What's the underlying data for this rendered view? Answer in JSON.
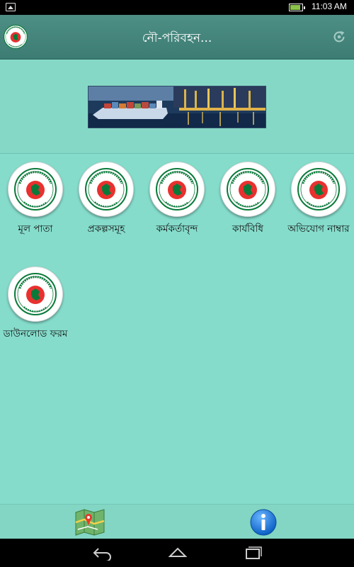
{
  "status_bar": {
    "time": "11:03 AM",
    "battery_level": 0.85
  },
  "app_bar": {
    "title": "নৌ-পরিবহন..."
  },
  "menu": {
    "items": [
      {
        "label": "মূল পাতা"
      },
      {
        "label": "প্রকল্পসমূহ"
      },
      {
        "label": "কর্মকর্তাবৃন্দ"
      },
      {
        "label": "কার্যবিধি"
      },
      {
        "label": "অভিযোগ নাম্বার"
      },
      {
        "label": "ডাউনলোড ফরম"
      }
    ]
  },
  "colors": {
    "background": "#85dccb",
    "app_bar": "#4e8f85",
    "seal_red": "#e8312f",
    "seal_green": "#0a7a3a"
  },
  "icons": {
    "app_logo": "govt-seal-icon",
    "refresh": "refresh-icon",
    "map": "map-icon",
    "info": "info-icon"
  }
}
